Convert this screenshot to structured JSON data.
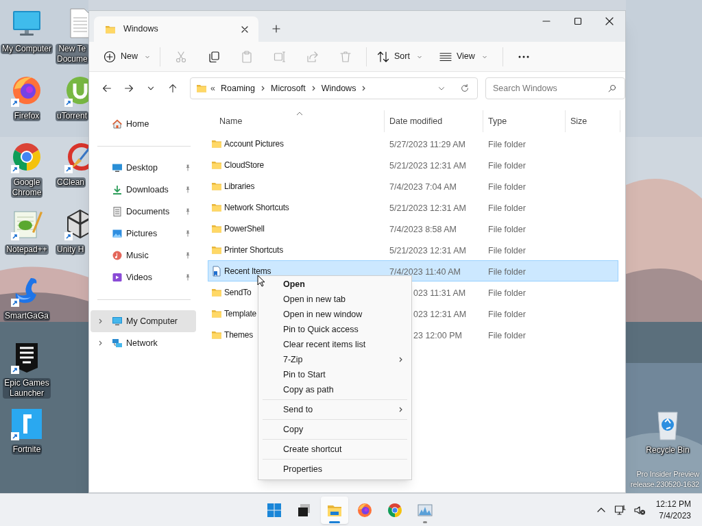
{
  "desktop_icons": [
    {
      "kind": "computer",
      "lines": [
        "My Computer"
      ],
      "shortcut": false
    },
    {
      "kind": "firefox",
      "lines": [
        "Firefox"
      ],
      "shortcut": true
    },
    {
      "kind": "chrome",
      "lines": [
        "Google",
        "Chrome"
      ],
      "shortcut": true
    },
    {
      "kind": "notepad",
      "lines": [
        "Notepad++"
      ],
      "shortcut": true
    },
    {
      "kind": "swan",
      "lines": [
        "SmartGaGa"
      ],
      "shortcut": true
    },
    {
      "kind": "epic",
      "lines": [
        "Epic Games",
        "Launcher"
      ],
      "shortcut": true
    },
    {
      "kind": "fortnite",
      "lines": [
        "Fortnite"
      ],
      "shortcut": true
    }
  ],
  "desktop_icons_column_2": [
    {
      "kind": "document",
      "lines": [
        "New Te",
        "Docume"
      ],
      "shortcut": false
    },
    {
      "kind": "utorrent",
      "lines": [
        "uTorrent"
      ],
      "shortcut": true
    },
    {
      "kind": "ccleaner",
      "lines": [
        "CClean"
      ],
      "shortcut": true
    },
    {
      "kind": "unity",
      "lines": [
        "Unity H"
      ],
      "shortcut": true
    }
  ],
  "recycle_bin": {
    "lines": [
      "Recycle Bin"
    ]
  },
  "build_watermark": [
    "Pro Insider Preview",
    "release.230520-1632"
  ],
  "explorer": {
    "tab_title": "Windows",
    "toolbar": [
      {
        "kind": "new",
        "label": "New",
        "disabled": false
      },
      {
        "kind": "cut",
        "disabled": true
      },
      {
        "kind": "copy",
        "disabled": false
      },
      {
        "kind": "paste",
        "disabled": true
      },
      {
        "kind": "rename",
        "disabled": true
      },
      {
        "kind": "share",
        "disabled": true
      },
      {
        "kind": "delete",
        "disabled": true
      },
      {
        "kind": "sort",
        "label": "Sort",
        "disabled": false
      },
      {
        "kind": "view",
        "label": "View",
        "disabled": false
      },
      {
        "kind": "more",
        "disabled": false
      }
    ],
    "address": {
      "overflow": "«",
      "crumbs": [
        "Roaming",
        "Microsoft",
        "Windows"
      ]
    },
    "search": {
      "placeholder": "Search Windows"
    },
    "sidebar": [
      {
        "kind": "home",
        "label": "Home",
        "selected": false
      },
      {
        "kind": "separator"
      },
      {
        "kind": "desktop",
        "label": "Desktop",
        "selected": false,
        "pinned": true
      },
      {
        "kind": "downloads",
        "label": "Downloads",
        "selected": false,
        "pinned": true
      },
      {
        "kind": "documents",
        "label": "Documents",
        "selected": false,
        "pinned": true
      },
      {
        "kind": "pictures",
        "label": "Pictures",
        "selected": false,
        "pinned": true
      },
      {
        "kind": "music",
        "label": "Music",
        "selected": false,
        "pinned": true
      },
      {
        "kind": "videos",
        "label": "Videos",
        "selected": false,
        "pinned": true
      },
      {
        "kind": "separator"
      },
      {
        "kind": "computer",
        "label": "My Computer",
        "selected": true,
        "expandable": true
      },
      {
        "kind": "network",
        "label": "Network",
        "selected": false,
        "expandable": true
      }
    ],
    "columns": [
      {
        "label": "Name",
        "sorted": true
      },
      {
        "label": "Date modified",
        "sorted": false
      },
      {
        "label": "Type",
        "sorted": false
      },
      {
        "label": "Size",
        "sorted": false
      }
    ],
    "rows": [
      {
        "kind": "folder",
        "name": "Account Pictures",
        "date": "5/27/2023 11:29 AM",
        "type": "File folder",
        "selected": false
      },
      {
        "kind": "folder",
        "name": "CloudStore",
        "date": "5/21/2023 12:31 AM",
        "type": "File folder",
        "selected": false
      },
      {
        "kind": "folder",
        "name": "Libraries",
        "date": "7/4/2023 7:04 AM",
        "type": "File folder",
        "selected": false
      },
      {
        "kind": "folder",
        "name": "Network Shortcuts",
        "date": "5/21/2023 12:31 AM",
        "type": "File folder",
        "selected": false
      },
      {
        "kind": "folder",
        "name": "PowerShell",
        "date": "7/4/2023 8:58 AM",
        "type": "File folder",
        "selected": false
      },
      {
        "kind": "folder",
        "name": "Printer Shortcuts",
        "date": "5/21/2023 12:31 AM",
        "type": "File folder",
        "selected": false
      },
      {
        "kind": "recent",
        "name": "Recent Items",
        "date": "7/4/2023 11:40 AM",
        "type": "File folder",
        "selected": true
      },
      {
        "kind": "folder",
        "name": "SendTo",
        "date": "023 11:31 AM",
        "type": "File folder",
        "selected": false
      },
      {
        "kind": "folder",
        "name": "Template",
        "date": "023 12:31 AM",
        "type": "File folder",
        "selected": false
      },
      {
        "kind": "folder",
        "name": "Themes",
        "date": "23 12:00 PM",
        "type": "File folder",
        "selected": false
      }
    ]
  },
  "context_menu": [
    {
      "kind": "item",
      "label": "Open",
      "bold": true
    },
    {
      "kind": "item",
      "label": "Open in new tab"
    },
    {
      "kind": "item",
      "label": "Open in new window"
    },
    {
      "kind": "item",
      "label": "Pin to Quick access"
    },
    {
      "kind": "item",
      "label": "Clear recent items list"
    },
    {
      "kind": "item",
      "label": "7-Zip",
      "submenu": true
    },
    {
      "kind": "item",
      "label": "Pin to Start"
    },
    {
      "kind": "item",
      "label": "Copy as path"
    },
    {
      "kind": "separator"
    },
    {
      "kind": "item",
      "label": "Send to",
      "submenu": true
    },
    {
      "kind": "separator"
    },
    {
      "kind": "item",
      "label": "Copy"
    },
    {
      "kind": "separator"
    },
    {
      "kind": "item",
      "label": "Create shortcut"
    },
    {
      "kind": "separator"
    },
    {
      "kind": "item",
      "label": "Properties"
    }
  ],
  "taskbar": {
    "apps": [
      {
        "kind": "start",
        "active": false,
        "running": false
      },
      {
        "kind": "taskview",
        "active": false,
        "running": false
      },
      {
        "kind": "explorer",
        "active": true,
        "running": true
      },
      {
        "kind": "firefox",
        "active": false,
        "running": false
      },
      {
        "kind": "chrome",
        "active": false,
        "running": false
      },
      {
        "kind": "monitor",
        "active": false,
        "running": true
      }
    ],
    "time": "12:12 PM",
    "date": "7/4/2023"
  }
}
